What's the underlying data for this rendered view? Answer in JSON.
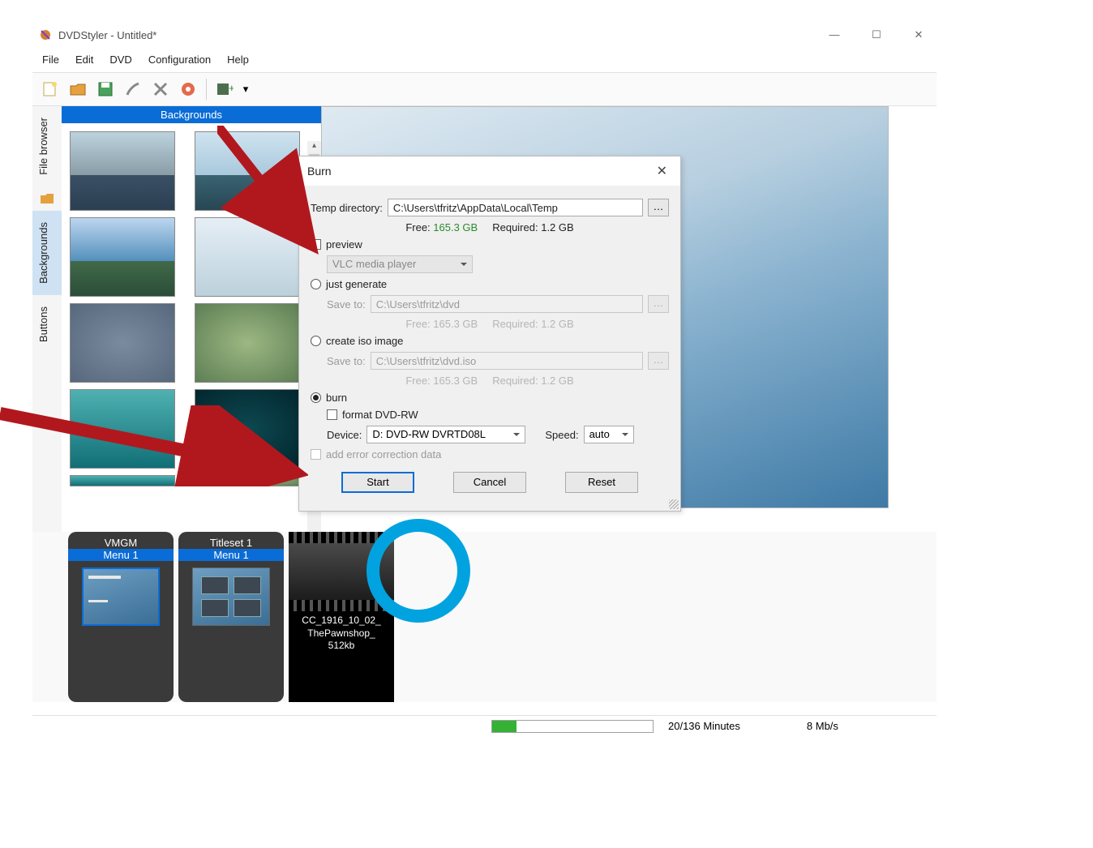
{
  "window": {
    "title": "DVDStyler - Untitled*",
    "controls": {
      "min": "—",
      "max": "☐",
      "close": "✕"
    }
  },
  "menu": {
    "file": "File",
    "edit": "Edit",
    "dvd": "DVD",
    "config": "Configuration",
    "help": "Help"
  },
  "side": {
    "file_browser": "File browser",
    "backgrounds": "Backgrounds",
    "buttons": "Buttons"
  },
  "bg_panel": {
    "header": "Backgrounds"
  },
  "timeline": {
    "vmgm": {
      "top": "VMGM",
      "sub": "Menu 1"
    },
    "titleset": {
      "top": "Titleset 1",
      "sub": "Menu 1"
    },
    "clip": "CC_1916_10_02_\nThePawnshop_\n512kb"
  },
  "status": {
    "minutes": "20/136 Minutes",
    "rate": "8 Mb/s"
  },
  "dialog": {
    "title": "Burn",
    "temp_label": "Temp directory:",
    "temp_value": "C:\\Users\\tfritz\\AppData\\Local\\Temp",
    "free_label": "Free:",
    "free_value": "165.3 GB",
    "req_label": "Required:",
    "req_value": "1.2 GB",
    "preview": "preview",
    "player": "VLC media player",
    "just_generate": "just generate",
    "save_to": "Save to:",
    "save_dvd": "C:\\Users\\tfritz\\dvd",
    "gen_free": "Free: 165.3 GB",
    "gen_req": "Required: 1.2 GB",
    "create_iso": "create iso image",
    "save_iso": "C:\\Users\\tfritz\\dvd.iso",
    "iso_free": "Free: 165.3 GB",
    "iso_req": "Required: 1.2 GB",
    "burn": "burn",
    "format": "format DVD-RW",
    "device_label": "Device:",
    "device_value": "D: DVD-RW  DVRTD08L",
    "speed_label": "Speed:",
    "speed_value": "auto",
    "ecc": "add error correction data",
    "start": "Start",
    "cancel": "Cancel",
    "reset": "Reset"
  }
}
